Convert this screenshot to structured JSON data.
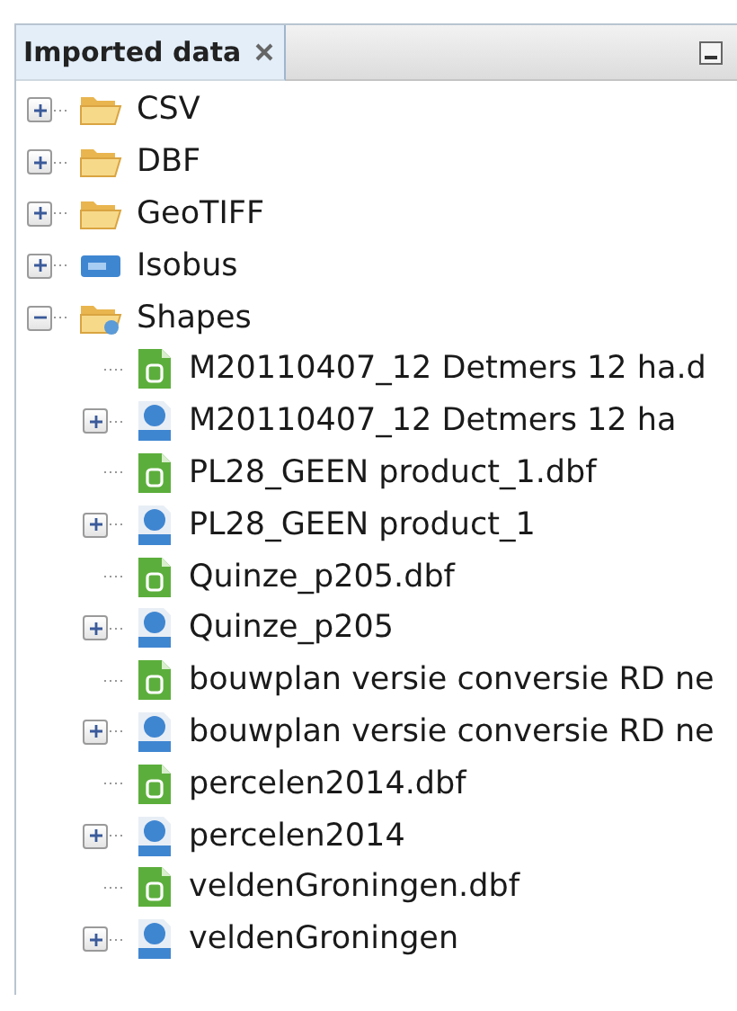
{
  "panel": {
    "title": "Imported data"
  },
  "tree": [
    {
      "label": "CSV",
      "kind": "folder",
      "expanded": false
    },
    {
      "label": "DBF",
      "kind": "folder",
      "expanded": false
    },
    {
      "label": "GeoTIFF",
      "kind": "folder",
      "expanded": false
    },
    {
      "label": "Isobus",
      "kind": "isobus",
      "expanded": false
    },
    {
      "label": "Shapes",
      "kind": "shapes-folder",
      "expanded": true,
      "children": [
        {
          "label": "M20110407_12 Detmers 12 ha.d",
          "kind": "dbf"
        },
        {
          "label": "M20110407_12 Detmers 12 ha",
          "kind": "shape",
          "expanded": false
        },
        {
          "label": "PL28_GEEN product_1.dbf",
          "kind": "dbf"
        },
        {
          "label": "PL28_GEEN product_1",
          "kind": "shape",
          "expanded": false
        },
        {
          "label": "Quinze_p205.dbf",
          "kind": "dbf"
        },
        {
          "label": "Quinze_p205",
          "kind": "shape",
          "expanded": false
        },
        {
          "label": "bouwplan versie conversie RD ne",
          "kind": "dbf"
        },
        {
          "label": "bouwplan versie conversie RD ne",
          "kind": "shape",
          "expanded": false
        },
        {
          "label": "percelen2014.dbf",
          "kind": "dbf"
        },
        {
          "label": "percelen2014",
          "kind": "shape",
          "expanded": false
        },
        {
          "label": "veldenGroningen.dbf",
          "kind": "dbf"
        },
        {
          "label": "veldenGroningen",
          "kind": "shape",
          "expanded": false
        }
      ]
    }
  ]
}
